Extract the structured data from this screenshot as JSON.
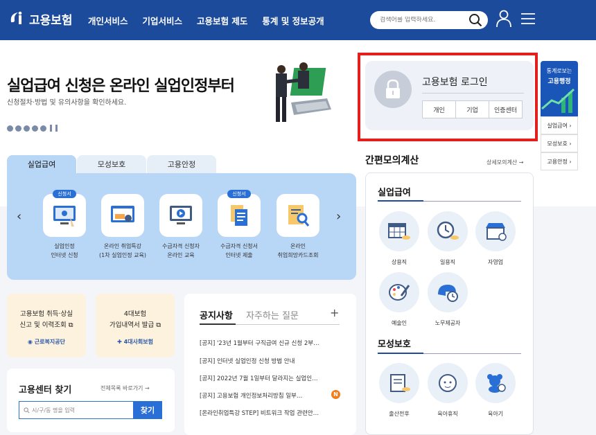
{
  "header": {
    "logo_text": "고용보험",
    "nav": [
      "개인서비스",
      "기업서비스",
      "고용보험 제도",
      "통계 및 정보공개"
    ],
    "search_placeholder": "검색어를 입력하세요."
  },
  "hero": {
    "title": "실업급여 신청은 온라인 실업인정부터",
    "subtitle": "신청절차·방법 및 유의사항을 확인하세요."
  },
  "login": {
    "title": "고용보험 로그인",
    "buttons": [
      "개인",
      "기업",
      "인증센터"
    ]
  },
  "side": {
    "banner_line1": "통계로보는",
    "banner_line2": "고용행정",
    "links": [
      "실업급여 ›",
      "모성보호 ›",
      "고용안정 ›"
    ]
  },
  "tabs": [
    "실업급여",
    "모성보호",
    "고용안정"
  ],
  "services": [
    {
      "line1": "실업인정",
      "line2": "인터넷 신청",
      "badge": "신청서"
    },
    {
      "line1": "온라인 취업특강",
      "line2": "(1차 실업인정 교육)",
      "badge": ""
    },
    {
      "line1": "수급자격 신청자",
      "line2": "온라인 교육",
      "badge": ""
    },
    {
      "line1": "수급자격 신청서",
      "line2": "인터넷 제출",
      "badge": "신청서"
    },
    {
      "line1": "온라인",
      "line2": "취업희망카드조회",
      "badge": ""
    }
  ],
  "cards": [
    {
      "line1": "고용보험 취득·상실",
      "line2": "신고 및 이력조회",
      "source": "근로복지공단"
    },
    {
      "line1": "4대보험",
      "line2": "가입내역서 발급",
      "source": "4대사회보험"
    }
  ],
  "center": {
    "title": "고용센터 찾기",
    "link": "전체목록 바로가기",
    "placeholder": "시/구/동 명을 입력",
    "button": "찾기"
  },
  "notice": {
    "tab_active": "공지사항",
    "tab_other": "자주하는 질문",
    "plus": "+",
    "new_badge": "N",
    "items": [
      "[공지] '23년 1월부터 구직급여 신규 신청 2부…",
      "[공지] 인터넷 실업인정 신청 방법 안내",
      "[공지] 2022년 7월 1일부터 달라지는 실업인…",
      "[공지] 고용보험 개인정보처리방침 일부…",
      "[온라인취업특강 STEP] 비트워크 작업 관련안…"
    ]
  },
  "calc": {
    "title": "간편모의계산",
    "link": "상세모의계산 →",
    "section1": "실업급여",
    "section1_items": [
      "상용직",
      "일용직",
      "자영업",
      "예술인",
      "노무제공자"
    ],
    "section2": "모성보호",
    "section2_items": [
      "출산전후",
      "육아휴직",
      "육아기"
    ]
  },
  "colors": {
    "header": "#1d4b9c",
    "accent": "#2a6fd6",
    "highlight": "#e41d1d"
  }
}
